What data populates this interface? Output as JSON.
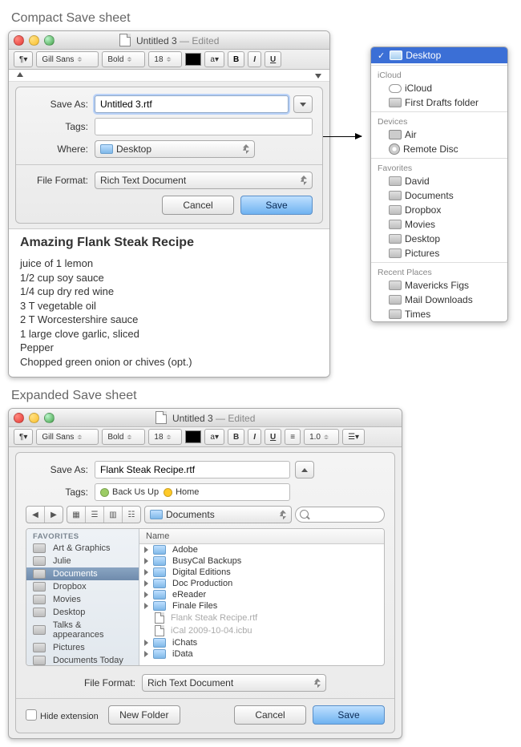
{
  "labels": {
    "compact_title": "Compact Save sheet",
    "expanded_title": "Expanded Save sheet",
    "save_as": "Save As:",
    "tags": "Tags:",
    "where": "Where:",
    "file_format": "File Format:",
    "cancel": "Cancel",
    "save": "Save",
    "hide_ext": "Hide extension",
    "new_folder": "New Folder",
    "name_col": "Name",
    "favorites": "FAVORITES"
  },
  "window": {
    "title": "Untitled 3",
    "edited": "— Edited"
  },
  "toolbar": {
    "font": "Gill Sans",
    "weight": "Bold",
    "size": "18",
    "b": "B",
    "i": "I",
    "u": "U",
    "spacing": "1.0"
  },
  "compact": {
    "save_as_value": "Untitled 3.rtf",
    "tags_value": "",
    "where_value": "Desktop",
    "file_format_value": "Rich Text Document"
  },
  "document": {
    "heading": "Amazing Flank Steak Recipe",
    "lines": [
      "juice of 1 lemon",
      "1/2 cup soy sauce",
      "1/4 cup dry red wine",
      "3 T vegetable oil",
      "2 T Worcestershire sauce",
      "1 large clove garlic, sliced",
      "Pepper",
      "Chopped green onion or chives (opt.)"
    ]
  },
  "menu": {
    "selected": "Desktop",
    "groups": [
      {
        "label": "iCloud",
        "items": [
          {
            "icon": "cloud",
            "label": "iCloud"
          },
          {
            "icon": "folder",
            "label": "First Drafts folder"
          }
        ]
      },
      {
        "label": "Devices",
        "items": [
          {
            "icon": "disk",
            "label": "Air"
          },
          {
            "icon": "disc",
            "label": "Remote Disc"
          }
        ]
      },
      {
        "label": "Favorites",
        "items": [
          {
            "icon": "folder",
            "label": "David"
          },
          {
            "icon": "folder",
            "label": "Documents"
          },
          {
            "icon": "folder",
            "label": "Dropbox"
          },
          {
            "icon": "folder",
            "label": "Movies"
          },
          {
            "icon": "folder",
            "label": "Desktop"
          },
          {
            "icon": "folder",
            "label": "Pictures"
          }
        ]
      },
      {
        "label": "Recent Places",
        "items": [
          {
            "icon": "folder",
            "label": "Mavericks Figs"
          },
          {
            "icon": "folder",
            "label": "Mail Downloads"
          },
          {
            "icon": "folder",
            "label": "Times"
          }
        ]
      }
    ]
  },
  "expanded": {
    "save_as_value": "Flank Steak Recipe.rtf",
    "tags": [
      {
        "color": "#9ccc65",
        "label": "Back Us Up"
      },
      {
        "color": "#ffca28",
        "label": "Home"
      }
    ],
    "location": "Documents",
    "file_format_value": "Rich Text Document",
    "sidebar": [
      {
        "label": "Art & Graphics"
      },
      {
        "label": "Julie"
      },
      {
        "label": "Documents",
        "selected": true
      },
      {
        "label": "Dropbox"
      },
      {
        "label": "Movies"
      },
      {
        "label": "Desktop"
      },
      {
        "label": "Talks & appearances"
      },
      {
        "label": "Pictures"
      },
      {
        "label": "Documents Today"
      }
    ],
    "files": [
      {
        "type": "folder",
        "label": "Adobe"
      },
      {
        "type": "folder",
        "label": "BusyCal Backups"
      },
      {
        "type": "folder",
        "label": "Digital Editions"
      },
      {
        "type": "folder",
        "label": "Doc Production"
      },
      {
        "type": "folder",
        "label": "eReader"
      },
      {
        "type": "folder",
        "label": "Finale Files"
      },
      {
        "type": "file",
        "label": "Flank Steak Recipe.rtf",
        "dim": true
      },
      {
        "type": "file",
        "label": "iCal 2009-10-04.icbu",
        "dim": true
      },
      {
        "type": "folder",
        "label": "iChats"
      },
      {
        "type": "folder",
        "label": "iData"
      }
    ]
  }
}
